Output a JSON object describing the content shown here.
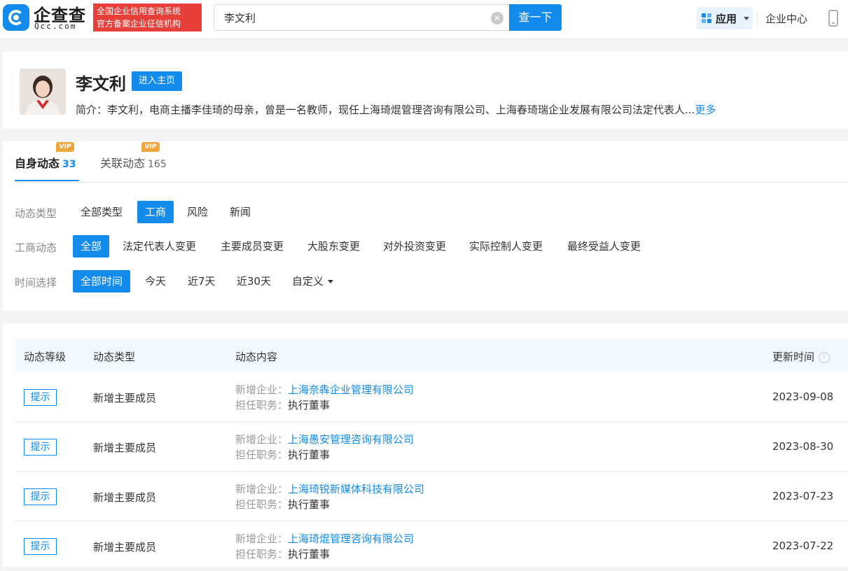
{
  "header": {
    "logo_text": "企查查",
    "logo_sub": "Qcc.com",
    "slogan_line1": "全国企业信用查询系统",
    "slogan_line2": "官方备案企业征信机构",
    "search_value": "李文利",
    "search_button": "查一下",
    "app_label": "应用",
    "enterprise_center": "企业中心"
  },
  "profile": {
    "name": "李文利",
    "home_button": "进入主页",
    "intro": "简介：李文利，电商主播李佳琦的母亲，曾是一名教师，现任上海琦焜管理咨询有限公司、上海春琦瑞企业发展有限公司法定代表人...",
    "more": "更多"
  },
  "tabs": [
    {
      "label": "自身动态",
      "count": "33",
      "vip": "VIP"
    },
    {
      "label": "关联动态",
      "count": "165",
      "vip": "VIP"
    }
  ],
  "filters": {
    "type_label": "动态类型",
    "type_options": [
      "全部类型",
      "工商",
      "风险",
      "新闻"
    ],
    "biz_label": "工商动态",
    "biz_options": [
      "全部",
      "法定代表人变更",
      "主要成员变更",
      "大股东变更",
      "对外投资变更",
      "实际控制人变更",
      "最终受益人变更"
    ],
    "time_label": "时间选择",
    "time_options": [
      "全部时间",
      "今天",
      "近7天",
      "近30天",
      "自定义"
    ]
  },
  "table": {
    "headers": [
      "动态等级",
      "动态类型",
      "动态内容",
      "更新时间"
    ],
    "rows": [
      {
        "level": "提示",
        "type": "新增主要成员",
        "company_key": "新增企业：",
        "company": "上海奈犇企业管理有限公司",
        "role_key": "担任职务：",
        "role": "执行董事",
        "date": "2023-09-08"
      },
      {
        "level": "提示",
        "type": "新增主要成员",
        "company_key": "新增企业：",
        "company": "上海愚安管理咨询有限公司",
        "role_key": "担任职务：",
        "role": "执行董事",
        "date": "2023-08-30"
      },
      {
        "level": "提示",
        "type": "新增主要成员",
        "company_key": "新增企业：",
        "company": "上海琦锐新媒体科技有限公司",
        "role_key": "担任职务：",
        "role": "执行董事",
        "date": "2023-07-23"
      },
      {
        "level": "提示",
        "type": "新增主要成员",
        "company_key": "新增企业：",
        "company": "上海琦焜管理咨询有限公司",
        "role_key": "担任职务：",
        "role": "执行董事",
        "date": "2023-07-22"
      }
    ]
  },
  "colors": {
    "accent": "#128bed",
    "slogan_bg": "#e7403b",
    "vip": "#f0a53c"
  }
}
